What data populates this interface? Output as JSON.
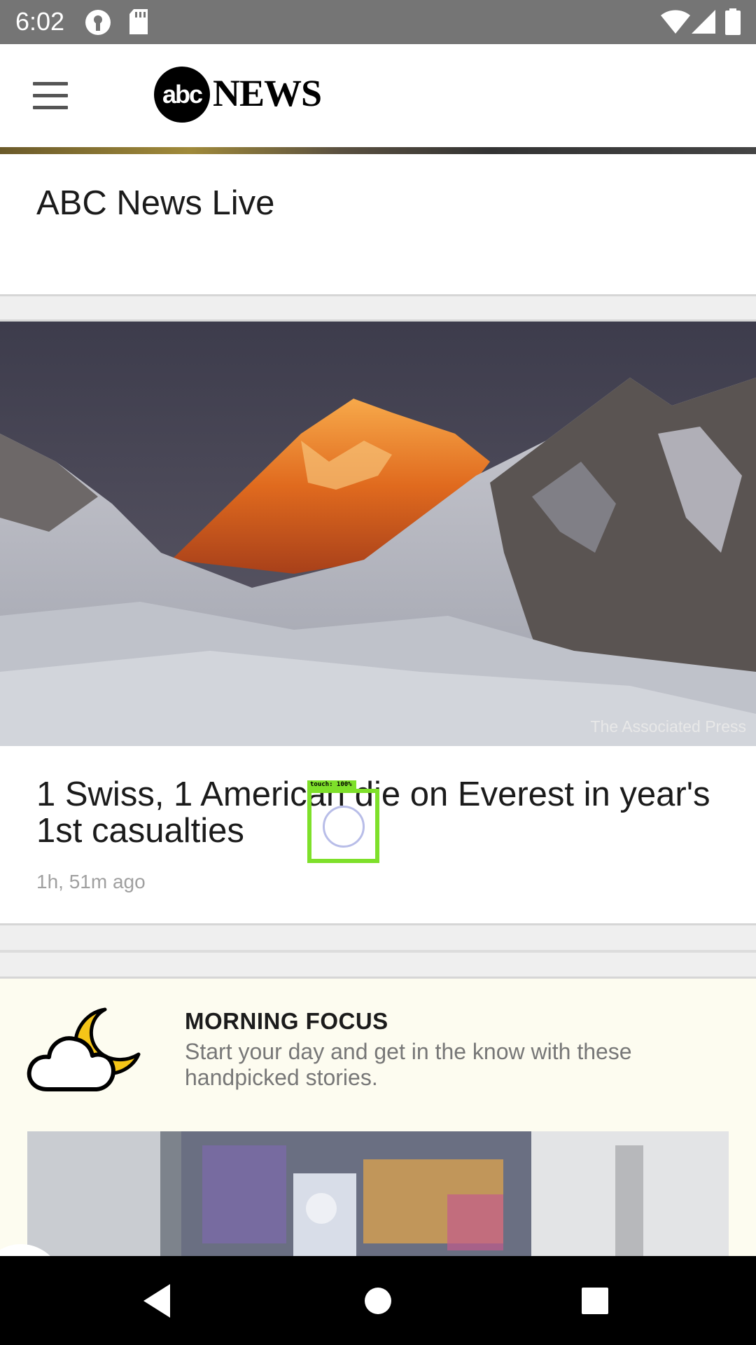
{
  "status_bar": {
    "time": "6:02",
    "icons": [
      "vpn-key-icon",
      "sd-card-icon",
      "wifi-icon",
      "signal-icon",
      "battery-icon"
    ]
  },
  "app_bar": {
    "menu_icon": "hamburger-menu-icon",
    "logo_text": "abcNEWS"
  },
  "live_card": {
    "title": "ABC News Live"
  },
  "story": {
    "image_credit": "The Associated Press",
    "headline": "1 Swiss, 1 American die on Everest in year's 1st casualties",
    "time_ago": "1h, 51m ago"
  },
  "touch_overlay": {
    "label": "touch: 100%"
  },
  "morning_focus": {
    "icon": "cloud-moon-icon",
    "title": "MORNING FOCUS",
    "description": "Start your day and get in the know with these handpicked stories."
  },
  "nav_bar": {
    "back": "back-icon",
    "home": "home-icon",
    "recents": "recents-icon"
  },
  "colors": {
    "status_bar": "#757575",
    "touch_highlight": "#7ee02a",
    "focus_background": "#fdfcf0",
    "moon": "#f5c518"
  }
}
